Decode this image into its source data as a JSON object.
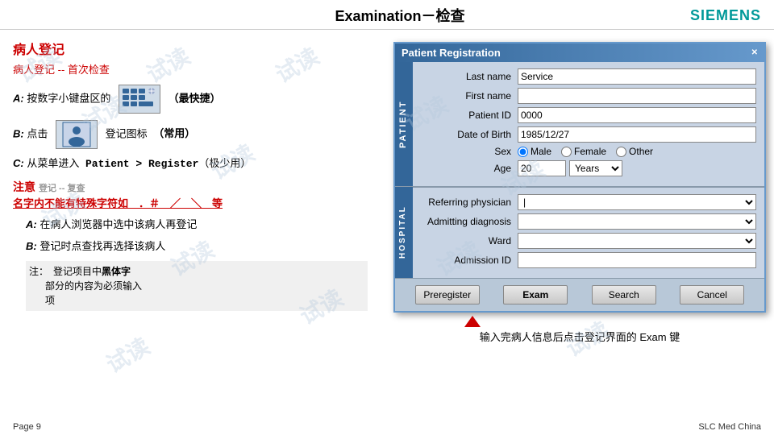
{
  "header": {
    "logo": "SIEMENS",
    "title": "Examination－检查"
  },
  "left": {
    "section_title": "病人登记",
    "section_subtitle": "病人登记 -- 首次检查",
    "step_a_label": "A:",
    "step_a_text": "按数字小键盘区的",
    "step_a_suffix": "（最快捷）",
    "step_b_label": "B:",
    "step_b_text": "点击",
    "step_b_mid": "登记图标",
    "step_b_suffix": "（常用）",
    "step_c_label": "C:",
    "step_c_text": "从菜单进入",
    "step_c_bold": "Patient > Register",
    "step_c_suffix": "（极少用）",
    "notice_title": "注意",
    "notice_subtitle": "名字内不能有特殊字符如　．＃　／　＼　等",
    "notice_a_label": "A:",
    "notice_a_text": "在病人浏览器中选中该病人再登记",
    "notice_b_label": "B:",
    "notice_b_text": "登记时点查找再选择该病人",
    "note_label": "注：",
    "note_text": "登记项目中黑体字部分的内容为必须输入项",
    "footer_left": "Page 9",
    "footer_right": "SLC Med China"
  },
  "dialog": {
    "title": "Patient Registration",
    "tab_patient": "PATIENT",
    "tab_hospital": "HOSPITAL",
    "form": {
      "last_name_label": "Last name",
      "last_name_value": "Service",
      "first_name_label": "First name",
      "first_name_value": "",
      "patient_id_label": "Patient ID",
      "patient_id_value": "0000",
      "dob_label": "Date of Birth",
      "dob_value": "1985/12/27",
      "sex_label": "Sex",
      "sex_male": "Male",
      "sex_female": "Female",
      "sex_other": "Other",
      "age_label": "Age",
      "age_value": "20",
      "age_unit": "Years"
    },
    "hospital": {
      "referring_label": "Referring physician",
      "referring_value": "|",
      "admitting_label": "Admitting diagnosis",
      "admitting_value": "",
      "ward_label": "Ward",
      "ward_value": "",
      "admission_label": "Admission ID",
      "admission_value": ""
    },
    "buttons": {
      "preregister": "Preregister",
      "exam": "Exam",
      "search": "Search",
      "cancel": "Cancel"
    }
  },
  "bottom_desc": "输入完病人信息后点击登记界面的 Exam 键",
  "watermarks": [
    "试读",
    "试读",
    "试读",
    "试读",
    "试读",
    "试读",
    "试读",
    "试读",
    "试读",
    "试读",
    "试读",
    "试读",
    "试读"
  ]
}
